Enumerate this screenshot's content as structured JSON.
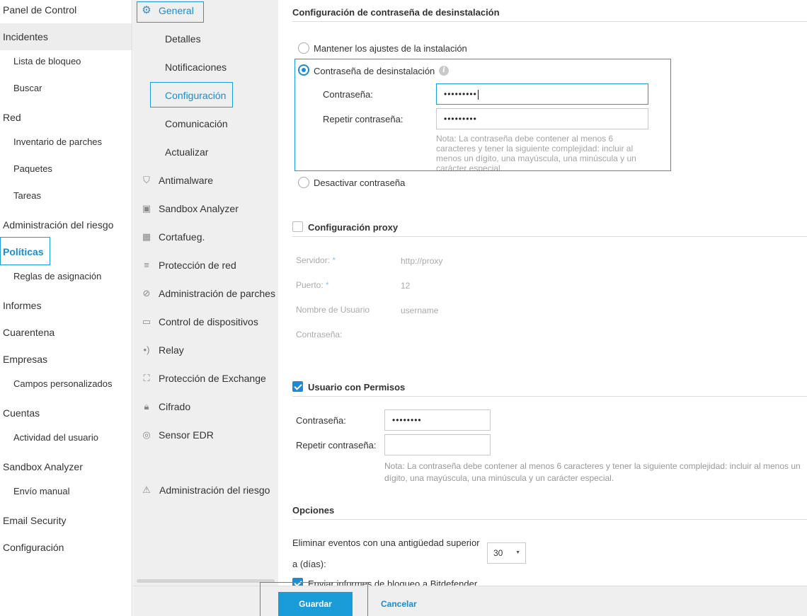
{
  "left_nav": {
    "items": [
      {
        "label": "Panel de Control",
        "level": "top"
      },
      {
        "label": "Incidentes",
        "level": "top"
      },
      {
        "label": "Lista de bloqueo",
        "level": "sub"
      },
      {
        "label": "Buscar",
        "level": "sub"
      },
      {
        "label": "Red",
        "level": "top"
      },
      {
        "label": "Inventario de parches",
        "level": "sub"
      },
      {
        "label": "Paquetes",
        "level": "sub"
      },
      {
        "label": "Tareas",
        "level": "sub"
      },
      {
        "label": "Administración del riesgo",
        "level": "top"
      },
      {
        "label": "Políticas",
        "level": "top"
      },
      {
        "label": "Reglas de asignación",
        "level": "sub"
      },
      {
        "label": "Informes",
        "level": "top"
      },
      {
        "label": "Cuarentena",
        "level": "top"
      },
      {
        "label": "Empresas",
        "level": "top"
      },
      {
        "label": "Campos personalizados",
        "level": "sub"
      },
      {
        "label": "Cuentas",
        "level": "top"
      },
      {
        "label": "Actividad del usuario",
        "level": "sub"
      },
      {
        "label": "Sandbox Analyzer",
        "level": "top"
      },
      {
        "label": "Envío manual",
        "level": "sub"
      },
      {
        "label": "Email Security",
        "level": "top"
      },
      {
        "label": "Configuración",
        "level": "top"
      }
    ]
  },
  "policy_nav": {
    "general": {
      "label": "General",
      "icon": "gear-icon"
    },
    "general_sub": [
      "Detalles",
      "Notificaciones",
      "Configuración",
      "Comunicación",
      "Actualizar"
    ],
    "modules": [
      {
        "label": "Antimalware",
        "icon": "shield-icon"
      },
      {
        "label": "Sandbox Analyzer",
        "icon": "cube-icon"
      },
      {
        "label": "Cortafueg.",
        "icon": "firewall-icon"
      },
      {
        "label": "Protección de red",
        "icon": "database-icon"
      },
      {
        "label": "Administración de parches",
        "icon": "bandage-icon"
      },
      {
        "label": "Control de dispositivos",
        "icon": "monitor-icon"
      },
      {
        "label": "Relay",
        "icon": "broadcast-icon"
      },
      {
        "label": "Protección de Exchange",
        "icon": "exchange-icon"
      },
      {
        "label": "Cifrado",
        "icon": "lock-icon"
      },
      {
        "label": "Sensor EDR",
        "icon": "sensor-icon"
      }
    ],
    "risk": {
      "label": "Administración del riesgo",
      "icon": "risk-icon"
    }
  },
  "uninstall": {
    "title": "Configuración de contraseña de desinstalación",
    "opt_keep": "Mantener los ajustes de la instalación",
    "opt_password": "Contraseña de desinstalación",
    "password_label": "Contraseña:",
    "password_value": "•••••••••",
    "repeat_label": "Repetir contraseña:",
    "repeat_value": "•••••••••",
    "note": "Nota: La contraseña debe contener al menos 6 caracteres y tener la siguiente complejidad: incluir al menos un dígito, una mayúscula, una minúscula y un carácter especial.",
    "opt_disable": "Desactivar contraseña"
  },
  "proxy": {
    "title": "Configuración proxy",
    "server_label": "Servidor:",
    "server_value": "http://proxy",
    "port_label": "Puerto:",
    "port_value": "12",
    "user_label": "Nombre de Usuario",
    "user_value": "username",
    "password_label": "Contraseña:",
    "required_mark": "*"
  },
  "power_user": {
    "title": "Usuario con Permisos",
    "password_label": "Contraseña:",
    "password_value": "••••••••",
    "repeat_label": "Repetir contraseña:",
    "repeat_value": "",
    "note": "Nota: La contraseña debe contener al menos 6 caracteres y tener la siguiente complejidad: incluir al menos un dígito, una mayúscula, una minúscula y un carácter especial."
  },
  "options": {
    "title": "Opciones",
    "delete_events_label_1": "Eliminar eventos con una antigüedad superior",
    "delete_events_label_2": "a (días):",
    "days_value": "30",
    "send_reports_label": "Enviar informes de bloqueo a Bitdefender"
  },
  "footer": {
    "save_label": "Guardar",
    "cancel_label": "Cancelar"
  },
  "colors": {
    "accent": "#1a8bd4",
    "accent_border": "#1a9cd8",
    "panel_bg": "#efefef"
  }
}
